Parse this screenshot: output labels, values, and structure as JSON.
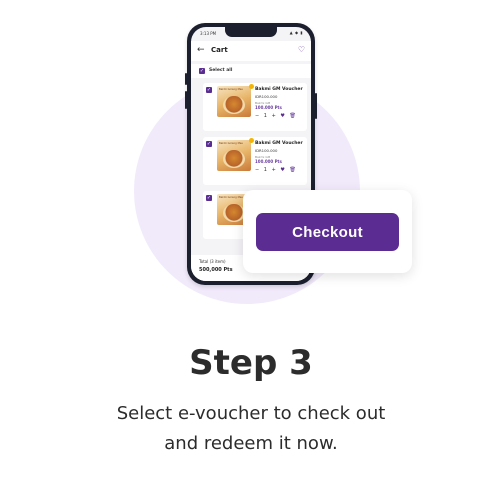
{
  "phone": {
    "status_time": "3:13 PM",
    "status_icons": "▲ ◆ ▮",
    "appbar": {
      "title": "Cart"
    },
    "select_all_label": "Select all",
    "items": [
      {
        "thumb_caption": "Bakmi Goreng Mee",
        "title": "Bakmi GM Voucher",
        "price": "IDR100.000",
        "subtitle": "Bakmi GM",
        "points": "100.000 Pts",
        "quantity": "1"
      },
      {
        "thumb_caption": "Bakmi Goreng Mee",
        "title": "Bakmi GM Voucher",
        "price": "IDR100.000",
        "subtitle": "Bakmi GM",
        "points": "100.000 Pts",
        "quantity": "1"
      },
      {
        "thumb_caption": "Bakmi Goreng Mee",
        "title": "",
        "price": "",
        "subtitle": "",
        "points": "",
        "quantity": ""
      }
    ],
    "footer": {
      "total_label": "Total (3 item)",
      "total_value": "500,000 Pts"
    }
  },
  "popup": {
    "checkout_label": "Checkout"
  },
  "step": {
    "title": "Step 3",
    "description_line1": "Select e-voucher to check out",
    "description_line2": "and redeem it now."
  },
  "colors": {
    "brand_purple": "#5b2c91",
    "circle_bg": "#f1eafb",
    "text_dark": "#2c2c2c"
  }
}
